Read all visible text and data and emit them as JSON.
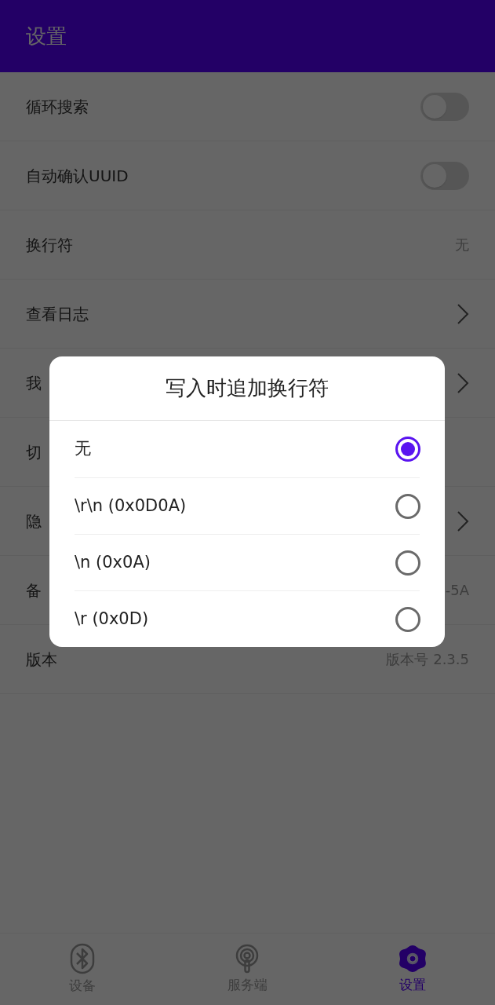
{
  "header": {
    "title": "设置"
  },
  "settings": [
    {
      "kind": "switch",
      "label": "循环搜索",
      "on": false
    },
    {
      "kind": "switch",
      "label": "自动确认UUID",
      "on": false
    },
    {
      "kind": "value",
      "label": "换行符",
      "value": "无"
    },
    {
      "kind": "link",
      "label": "查看日志"
    },
    {
      "kind": "link",
      "label": "我"
    },
    {
      "kind": "plain",
      "label": "切"
    },
    {
      "kind": "link",
      "label": "隐"
    },
    {
      "kind": "value",
      "label": "备",
      "value": "-5A"
    },
    {
      "kind": "value",
      "label": "版本",
      "value": "版本号 2.3.5"
    }
  ],
  "dialog": {
    "title": "写入时追加换行符",
    "options": [
      {
        "label": "无",
        "selected": true
      },
      {
        "label": "\\r\\n (0x0D0A)",
        "selected": false
      },
      {
        "label": "\\n (0x0A)",
        "selected": false
      },
      {
        "label": "\\r (0x0D)",
        "selected": false
      }
    ]
  },
  "bottom_nav": [
    {
      "kind": "bluetooth",
      "label": "设备",
      "selected": false
    },
    {
      "kind": "broadcast",
      "label": "服务端",
      "selected": false
    },
    {
      "kind": "gear",
      "label": "设置",
      "selected": true
    }
  ]
}
